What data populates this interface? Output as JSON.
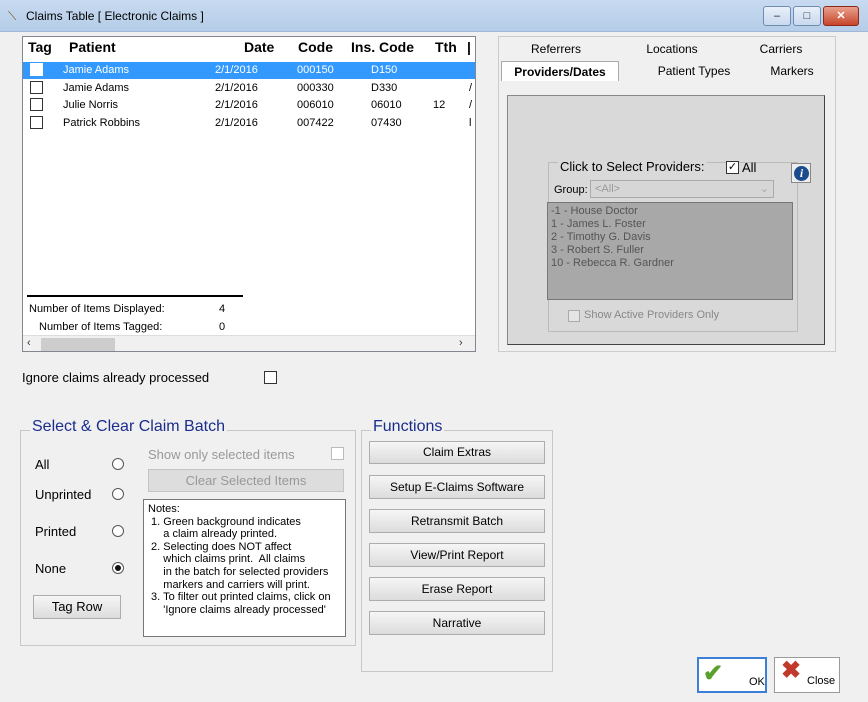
{
  "window": {
    "title": "Claims Table [ Electronic Claims ]",
    "minimize": "–",
    "maximize": "□",
    "close": "✕"
  },
  "table": {
    "headers": [
      "Tag",
      "Patient",
      "Date",
      "Code",
      "Ins. Code",
      "Tth",
      ""
    ],
    "rows": [
      {
        "patient": "Jamie Adams",
        "date": "2/1/2016",
        "code": "000150",
        "ins_code": "D150",
        "tth": "",
        "extra": "",
        "selected": true
      },
      {
        "patient": "Jamie Adams",
        "date": "2/1/2016",
        "code": "000330",
        "ins_code": "D330",
        "tth": "",
        "extra": "/",
        "selected": false
      },
      {
        "patient": "Julie Norris",
        "date": "2/1/2016",
        "code": "006010",
        "ins_code": "06010",
        "tth": "12",
        "extra": "/",
        "selected": false
      },
      {
        "patient": "Patrick Robbins",
        "date": "2/1/2016",
        "code": "007422",
        "ins_code": "07430",
        "tth": "",
        "extra": "l",
        "selected": false
      }
    ],
    "items_displayed_label": "Number of Items Displayed:",
    "items_displayed": "4",
    "items_tagged_label": "Number of Items Tagged:",
    "items_tagged": "0"
  },
  "tabs": {
    "row1": [
      "Referrers",
      "Locations",
      "Carriers"
    ],
    "row2": [
      "Providers/Dates",
      "Patient Types",
      "Markers"
    ],
    "active": "Providers/Dates"
  },
  "providers": {
    "label": "Click to Select Providers:",
    "all_label": "All",
    "all_checked": true,
    "group_label": "Group:",
    "group_value": "<All>",
    "list": [
      "-1 - House Doctor",
      "1 - James L. Foster",
      "2 - Timothy G. Davis",
      "3 - Robert S. Fuller",
      "10 - Rebecca R. Gardner"
    ],
    "active_only_label": "Show Active Providers Only"
  },
  "ignore_label": "Ignore claims already processed",
  "batch": {
    "title": "Select & Clear Claim Batch",
    "options": [
      "All",
      "Unprinted",
      "Printed",
      "None"
    ],
    "selected": "None",
    "show_selected_label": "Show only selected items",
    "clear_label": "Clear Selected Items",
    "tag_row_label": "Tag Row",
    "notes": "Notes:\n 1. Green background indicates\n     a claim already printed.\n 2. Selecting does NOT affect\n     which claims print.  All claims\n     in the batch for selected providers\n     markers and carriers will print.\n 3. To filter out printed claims, click on\n     'Ignore claims already processed'"
  },
  "functions": {
    "title": "Functions",
    "buttons": [
      "Claim Extras",
      "Setup E-Claims Software",
      "Retransmit Batch",
      "View/Print Report",
      "Erase Report",
      "Narrative"
    ]
  },
  "footer": {
    "ok_label": "OK",
    "close_label": "Close"
  },
  "colors": {
    "selection": "#3399ff",
    "group_title": "#1a2d8c",
    "ok_check": "#5aa02c",
    "close_x": "#c0392b"
  }
}
